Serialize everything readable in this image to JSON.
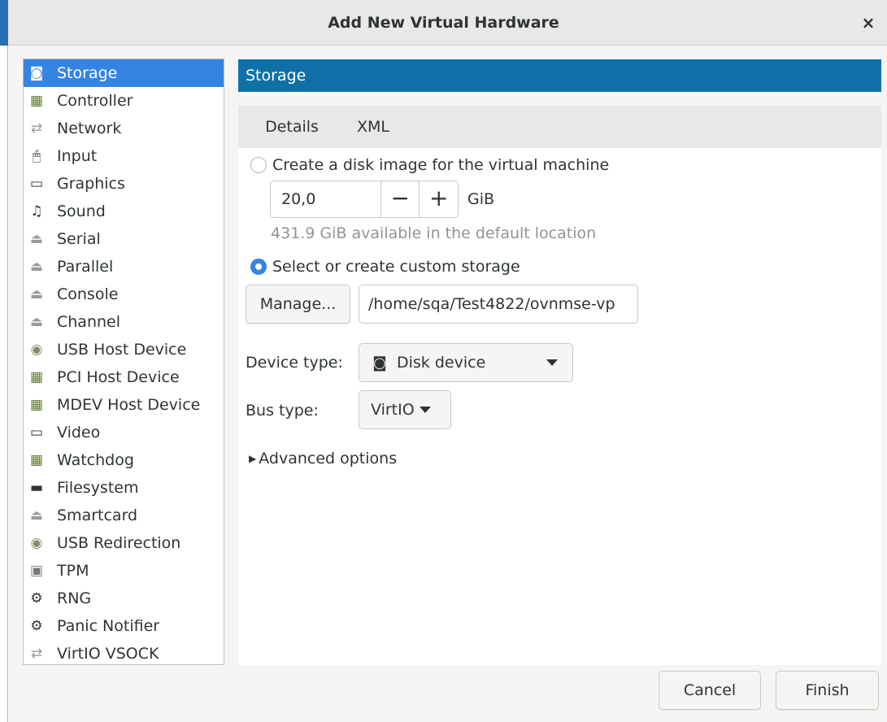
{
  "window": {
    "title": "Add New Virtual Hardware",
    "close_glyph": "×"
  },
  "hardware_list": [
    {
      "label": "Storage",
      "icon": "disk-icon",
      "glyph": "◙",
      "selected": true
    },
    {
      "label": "Controller",
      "icon": "pci-card-icon",
      "glyph": "▦"
    },
    {
      "label": "Network",
      "icon": "network-arrows-icon",
      "glyph": "⇄"
    },
    {
      "label": "Input",
      "icon": "mouse-icon",
      "glyph": "🖱"
    },
    {
      "label": "Graphics",
      "icon": "monitor-icon",
      "glyph": "▭"
    },
    {
      "label": "Sound",
      "icon": "sound-card-icon",
      "glyph": "♫"
    },
    {
      "label": "Serial",
      "icon": "serial-port-icon",
      "glyph": "⏏"
    },
    {
      "label": "Parallel",
      "icon": "parallel-port-icon",
      "glyph": "⏏"
    },
    {
      "label": "Console",
      "icon": "console-port-icon",
      "glyph": "⏏"
    },
    {
      "label": "Channel",
      "icon": "channel-port-icon",
      "glyph": "⏏"
    },
    {
      "label": "USB Host Device",
      "icon": "usb-icon",
      "glyph": "◉"
    },
    {
      "label": "PCI Host Device",
      "icon": "pci-card-icon",
      "glyph": "▦"
    },
    {
      "label": "MDEV Host Device",
      "icon": "pci-card-icon",
      "glyph": "▦"
    },
    {
      "label": "Video",
      "icon": "monitor-icon",
      "glyph": "▭"
    },
    {
      "label": "Watchdog",
      "icon": "pci-card-icon",
      "glyph": "▦"
    },
    {
      "label": "Filesystem",
      "icon": "folder-icon",
      "glyph": "▬"
    },
    {
      "label": "Smartcard",
      "icon": "smartcard-port-icon",
      "glyph": "⏏"
    },
    {
      "label": "USB Redirection",
      "icon": "usb-icon",
      "glyph": "◉"
    },
    {
      "label": "TPM",
      "icon": "chip-icon",
      "glyph": "▣"
    },
    {
      "label": "RNG",
      "icon": "gears-icon",
      "glyph": "⚙"
    },
    {
      "label": "Panic Notifier",
      "icon": "gears-icon",
      "glyph": "⚙"
    },
    {
      "label": "VirtIO VSOCK",
      "icon": "network-arrows-icon",
      "glyph": "⇄"
    }
  ],
  "pane": {
    "header": "Storage",
    "tabs": [
      {
        "label": "Details",
        "active": true
      },
      {
        "label": "XML",
        "active": false
      }
    ],
    "create_disk": {
      "label": "Create a disk image for the virtual machine",
      "checked": false,
      "size_value": "20,0",
      "minus": "−",
      "plus": "+",
      "unit": "GiB",
      "available": "431.9 GiB available in the default location"
    },
    "custom_storage": {
      "label": "Select or create custom storage",
      "checked": true,
      "manage_label": "Manage...",
      "path_value": "/home/sqa/Test4822/ovnmse-vp"
    },
    "device_type": {
      "label": "Device type:",
      "value": "Disk device",
      "icon": "disk-icon",
      "glyph": "◙"
    },
    "bus_type": {
      "label": "Bus type:",
      "value": "VirtIO"
    },
    "advanced": {
      "label": "Advanced options",
      "expanded": false,
      "glyph": "▶"
    }
  },
  "buttons": {
    "cancel": "Cancel",
    "finish": "Finish"
  }
}
